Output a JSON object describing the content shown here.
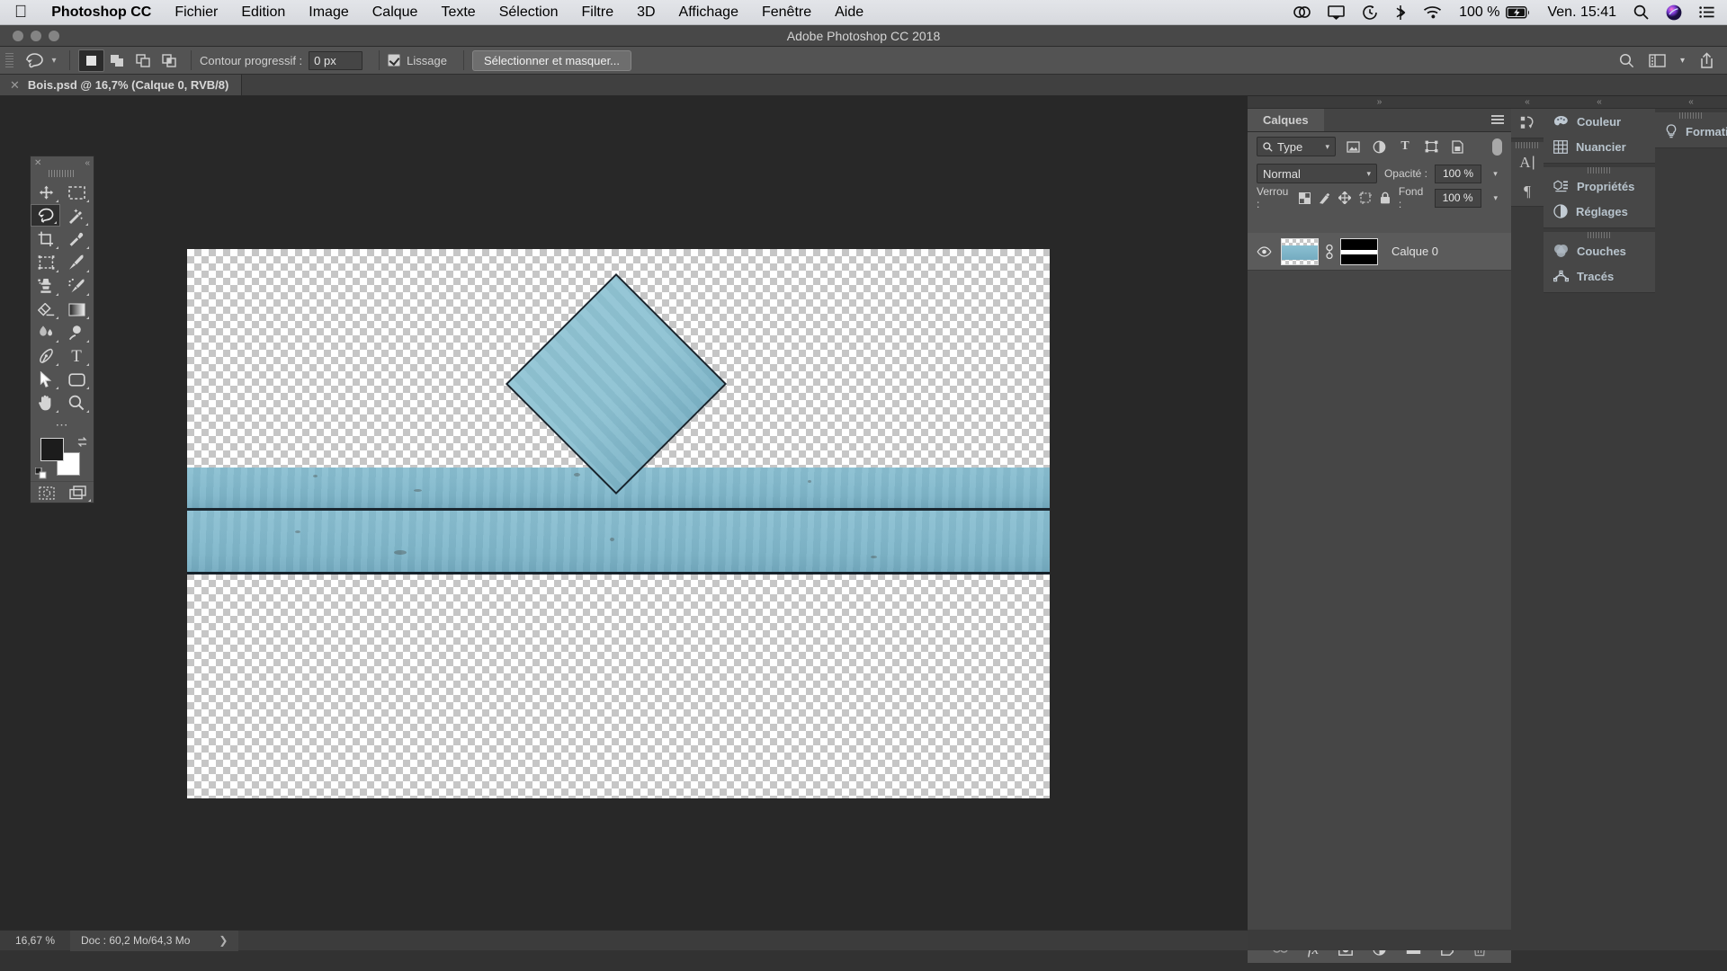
{
  "menubar": {
    "apple_icon": "apple-logo-icon",
    "app_name": "Photoshop CC",
    "items": [
      "Fichier",
      "Edition",
      "Image",
      "Calque",
      "Texte",
      "Sélection",
      "Filtre",
      "3D",
      "Affichage",
      "Fenêtre",
      "Aide"
    ],
    "status": {
      "creative_cloud_icon": "creative-cloud-icon",
      "airplay_icon": "airplay-icon",
      "timemachine_icon": "time-machine-icon",
      "bluetooth_icon": "bluetooth-icon",
      "wifi_icon": "wifi-icon",
      "battery_percent": "100 %",
      "battery_icon": "battery-charging-icon",
      "clock": "Ven. 15:41",
      "search_icon": "spotlight-search-icon",
      "siri_icon": "siri-icon",
      "notification_icon": "notification-center-icon"
    }
  },
  "window": {
    "title": "Adobe Photoshop CC 2018",
    "traffic_lights": [
      "close-button",
      "minimize-button",
      "zoom-button"
    ]
  },
  "options_bar": {
    "tool_icon": "lasso-tool-icon",
    "tool_preset_chevron": "chevron-down-icon",
    "selection_modes": [
      {
        "name": "new-selection",
        "icon": "square-filled-icon",
        "active": true
      },
      {
        "name": "add-to-selection",
        "icon": "squares-add-icon",
        "active": false
      },
      {
        "name": "subtract-from-selection",
        "icon": "squares-subtract-icon",
        "active": false
      },
      {
        "name": "intersect-selection",
        "icon": "squares-intersect-icon",
        "active": false
      }
    ],
    "feather_label": "Contour progressif :",
    "feather_value": "0 px",
    "antialias_label": "Lissage",
    "antialias_checked": true,
    "select_mask_button": "Sélectionner et masquer...",
    "right_icons": [
      "search-icon",
      "workspace-layout-icon",
      "chevron-down-icon",
      "share-icon"
    ]
  },
  "document_tab": {
    "close_icon": "close-icon",
    "title": "Bois.psd @ 16,7% (Calque 0, RVB/8)"
  },
  "toolbar": {
    "close_icon": "close-icon",
    "collapse_icon": "collapse-double-left-icon",
    "grip": "drag-handle",
    "tools": [
      {
        "name": "move-tool",
        "icon": "move-icon",
        "active": false,
        "has_flyout": true
      },
      {
        "name": "rectangular-marquee-tool",
        "icon": "dashed-rectangle-icon",
        "active": false,
        "has_flyout": true
      },
      {
        "name": "lasso-tool",
        "icon": "lasso-icon",
        "active": true,
        "has_flyout": true
      },
      {
        "name": "magic-wand-tool",
        "icon": "magic-wand-icon",
        "active": false,
        "has_flyout": true
      },
      {
        "name": "crop-tool",
        "icon": "crop-icon",
        "active": false,
        "has_flyout": true
      },
      {
        "name": "eyedropper-tool",
        "icon": "eyedropper-icon",
        "active": false,
        "has_flyout": true
      },
      {
        "name": "frame-tool",
        "icon": "dashed-frame-icon",
        "active": false,
        "has_flyout": true
      },
      {
        "name": "brush-tool",
        "icon": "paintbrush-icon",
        "active": false,
        "has_flyout": true
      },
      {
        "name": "clone-stamp-tool",
        "icon": "stamp-icon",
        "active": false,
        "has_flyout": true
      },
      {
        "name": "history-brush-tool",
        "icon": "history-brush-icon",
        "active": false,
        "has_flyout": true
      },
      {
        "name": "eraser-tool",
        "icon": "eraser-icon",
        "active": false,
        "has_flyout": true
      },
      {
        "name": "gradient-tool",
        "icon": "gradient-icon",
        "active": false,
        "has_flyout": true
      },
      {
        "name": "blur-tool",
        "icon": "blur-droplet-icon",
        "active": false,
        "has_flyout": true
      },
      {
        "name": "dodge-tool",
        "icon": "dodge-icon",
        "active": false,
        "has_flyout": true
      },
      {
        "name": "pen-tool",
        "icon": "pen-nib-icon",
        "active": false,
        "has_flyout": true
      },
      {
        "name": "type-tool",
        "icon": "text-t-icon",
        "active": false,
        "has_flyout": true
      },
      {
        "name": "path-selection-tool",
        "icon": "cursor-arrow-icon",
        "active": false,
        "has_flyout": true
      },
      {
        "name": "rectangle-shape-tool",
        "icon": "rounded-rectangle-icon",
        "active": false,
        "has_flyout": true
      },
      {
        "name": "hand-tool",
        "icon": "hand-icon",
        "active": false,
        "has_flyout": true
      },
      {
        "name": "zoom-tool",
        "icon": "magnifier-icon",
        "active": false,
        "has_flyout": true
      }
    ],
    "more_tools_icon": "ellipsis-icon",
    "foreground_color": "#1c1c1c",
    "background_color": "#ffffff",
    "swap_icon": "swap-colors-icon",
    "default_colors_icon": "default-colors-icon",
    "quick_mask_icon": "quick-mask-icon",
    "screen_mode_icon": "screen-mode-icon"
  },
  "canvas": {
    "zoom": "16,7%",
    "artwork_description": "blue painted wood planks band with rotated square diamond",
    "plank_color": "#86bccf",
    "seam_color": "#16222b"
  },
  "layers_panel": {
    "collapse_icon": "collapse-double-right-icon",
    "tab_label": "Calques",
    "menu_icon": "panel-menu-icon",
    "filter_label": "Type",
    "filter_search_icon": "search-icon",
    "filter_chevron": "chevron-down-icon",
    "filter_icons": [
      "image-filter-icon",
      "adjustment-filter-icon",
      "type-filter-icon",
      "shape-filter-icon",
      "smart-object-filter-icon"
    ],
    "filter_toggle": "filter-enable-toggle",
    "blend_mode": "Normal",
    "blend_chevron": "chevron-down-icon",
    "opacity_label": "Opacité :",
    "opacity_value": "100 %",
    "opacity_stepper": "chevron-down-icon",
    "lock_label": "Verrou :",
    "lock_icons": [
      "lock-transparency-icon",
      "lock-image-icon",
      "lock-position-icon",
      "lock-artboard-icon",
      "lock-all-icon"
    ],
    "fill_label": "Fond :",
    "fill_value": "100 %",
    "fill_stepper": "chevron-down-icon",
    "layers": [
      {
        "name": "Calque 0",
        "visible": true,
        "visibility_icon": "eye-icon",
        "thumbnail": "layer-thumbnail",
        "link_icon": "mask-link-icon",
        "mask_thumbnail": "layer-mask-thumbnail",
        "selected": true
      }
    ],
    "footer_icons": [
      {
        "name": "link-layers-button",
        "icon": "link-icon"
      },
      {
        "name": "layer-style-button",
        "icon": "fx-icon"
      },
      {
        "name": "add-layer-mask-button",
        "icon": "mask-icon"
      },
      {
        "name": "new-adjustment-layer-button",
        "icon": "half-circle-icon"
      },
      {
        "name": "new-group-button",
        "icon": "folder-icon"
      },
      {
        "name": "new-layer-button",
        "icon": "new-layer-icon"
      },
      {
        "name": "delete-layer-button",
        "icon": "trash-icon"
      }
    ]
  },
  "icon_dock": {
    "collapse_icon": "collapse-double-left-icon",
    "groups": [
      [
        {
          "name": "history-panel-icon",
          "label": "Historique"
        }
      ],
      [
        {
          "name": "character-panel-icon",
          "label": "Caractère"
        },
        {
          "name": "paragraph-panel-icon",
          "label": "Paragraphe"
        }
      ]
    ]
  },
  "collapsed_panels": {
    "collapse_icon": "collapse-double-left-icon",
    "groups": [
      [
        {
          "label": "Couleur",
          "icon": "color-palette-icon"
        },
        {
          "label": "Nuancier",
          "icon": "swatches-grid-icon"
        }
      ],
      [
        {
          "label": "Propriétés",
          "icon": "properties-icon"
        },
        {
          "label": "Réglages",
          "icon": "adjustments-icon"
        }
      ],
      [
        {
          "label": "Couches",
          "icon": "channels-icon"
        },
        {
          "label": "Tracés",
          "icon": "paths-icon"
        }
      ]
    ]
  },
  "right_panel": {
    "collapse_icon": "collapse-double-left-icon",
    "items": [
      {
        "label": "Formation",
        "icon": "lightbulb-icon"
      }
    ]
  },
  "status_bar": {
    "zoom": "16,67 %",
    "doc_info": "Doc : 60,2 Mo/64,3 Mo",
    "arrow_icon": "chevron-right-icon"
  }
}
